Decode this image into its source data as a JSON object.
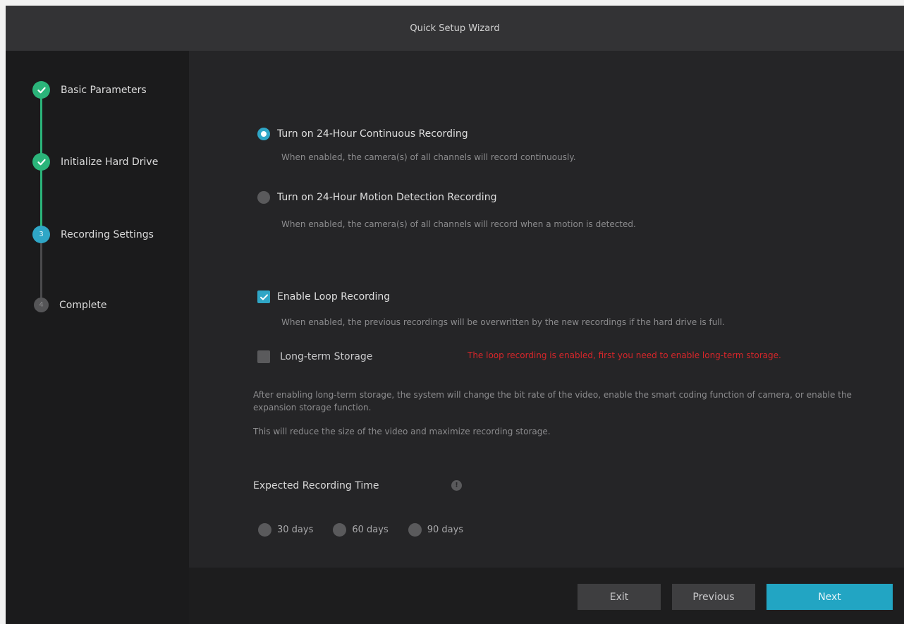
{
  "window": {
    "title": "Quick Setup Wizard"
  },
  "steps": [
    {
      "label": "Basic Parameters",
      "state": "done",
      "marker": "check-icon"
    },
    {
      "label": "Initialize Hard Drive",
      "state": "done",
      "marker": "check-icon"
    },
    {
      "label": "Recording Settings",
      "state": "active",
      "number": "3"
    },
    {
      "label": "Complete",
      "state": "todo",
      "number": "4"
    }
  ],
  "recording_mode": {
    "continuous": {
      "label": "Turn on 24-Hour Continuous Recording",
      "desc": "When enabled, the camera(s) of all channels will record continuously.",
      "selected": true
    },
    "motion": {
      "label": "Turn on 24-Hour Motion Detection Recording",
      "desc": "When enabled, the camera(s) of all channels will record when a motion is detected.",
      "selected": false
    }
  },
  "loop_recording": {
    "label": "Enable Loop Recording",
    "desc": "When enabled, the previous recordings will be overwritten by the new recordings if the hard drive is full.",
    "checked": true
  },
  "long_term": {
    "label": "Long-term Storage",
    "checked": false,
    "warning": "The loop recording is enabled, first you need to enable long-term storage.",
    "note_line1": "After enabling long-term storage, the system will change the bit rate of the video, enable the smart coding function of camera, or enable the expansion storage function.",
    "note_line2": "This will reduce the size of the video and maximize recording storage."
  },
  "expected_time": {
    "label": "Expected Recording Time",
    "info_glyph": "!",
    "options": [
      "30 days",
      "60 days",
      "90 days"
    ]
  },
  "footer": {
    "exit_label": "Exit",
    "previous_label": "Previous",
    "next_label": "Next"
  },
  "colors": {
    "accent": "#22a5c3",
    "done": "#2bb47a",
    "warning": "#d8262a"
  }
}
